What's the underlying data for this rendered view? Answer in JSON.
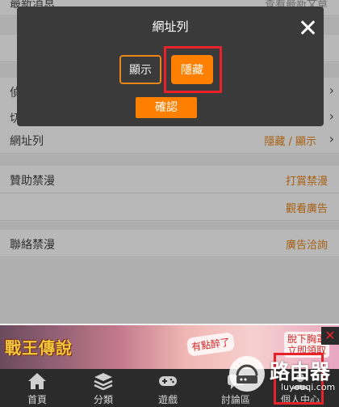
{
  "settings": {
    "news": {
      "label": "最新消息",
      "value": "查看最新文章"
    },
    "row2": {
      "label": "偵",
      "value": ""
    },
    "row3": {
      "label": "切",
      "value": ""
    },
    "url_list": {
      "label": "網址列",
      "value": "隱藏 / 顯示"
    },
    "sponsor": {
      "label": "贊助禁漫",
      "value": "打賞禁漫"
    },
    "ads": {
      "value": "觀看廣告"
    },
    "contact": {
      "label": "聯絡禁漫",
      "value": "廣告洽詢"
    }
  },
  "dialog": {
    "title": "網址列",
    "option_show": "顯示",
    "option_hide": "隱藏",
    "confirm": "確認",
    "selected": "隱藏"
  },
  "ad": {
    "game_title": "戰王傳說",
    "bubble1": "有點醉了",
    "bubble2_line1": "脫下胸罩",
    "bubble2_line2": "立即領取"
  },
  "nav": {
    "items": [
      {
        "label": "首頁",
        "icon": "home-icon"
      },
      {
        "label": "分類",
        "icon": "layers-icon"
      },
      {
        "label": "遊戲",
        "icon": "gamepad-icon"
      },
      {
        "label": "討論區",
        "icon": "chat-icon"
      },
      {
        "label": "個人中心",
        "icon": "user-icon"
      }
    ]
  },
  "watermark": {
    "title": "路由器",
    "subtitle": "luyouqi.com"
  },
  "colors": {
    "accent": "#ff7f00",
    "highlight": "#e8222a",
    "dialog_bg": "#3a3a3a",
    "nav_bg": "#2b2b2b"
  }
}
